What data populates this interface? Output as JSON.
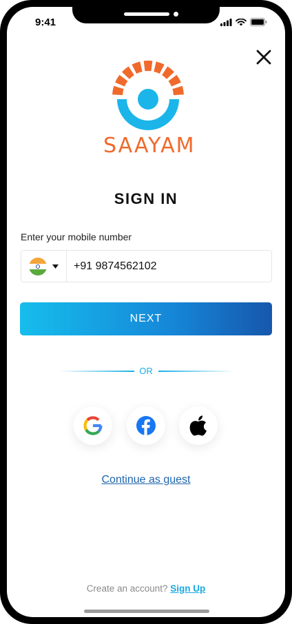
{
  "status_bar": {
    "time": "9:41"
  },
  "brand": {
    "name": "SAAYAM",
    "primary_color": "#f06a2c",
    "accent_color": "#1bb5ea"
  },
  "header": {
    "close_icon": "close-icon"
  },
  "signin": {
    "title": "SIGN IN",
    "phone_label": "Enter your mobile number",
    "country_flag": "india-flag-icon",
    "phone_value": "+91 9874562102",
    "next_label": "NEXT",
    "or_label": "OR"
  },
  "social_buttons": [
    {
      "name": "google",
      "icon": "google-icon"
    },
    {
      "name": "facebook",
      "icon": "facebook-icon"
    },
    {
      "name": "apple",
      "icon": "apple-icon"
    }
  ],
  "guest_label": "Continue as guest",
  "footer": {
    "prompt": "Create an account?",
    "link": "Sign Up"
  }
}
